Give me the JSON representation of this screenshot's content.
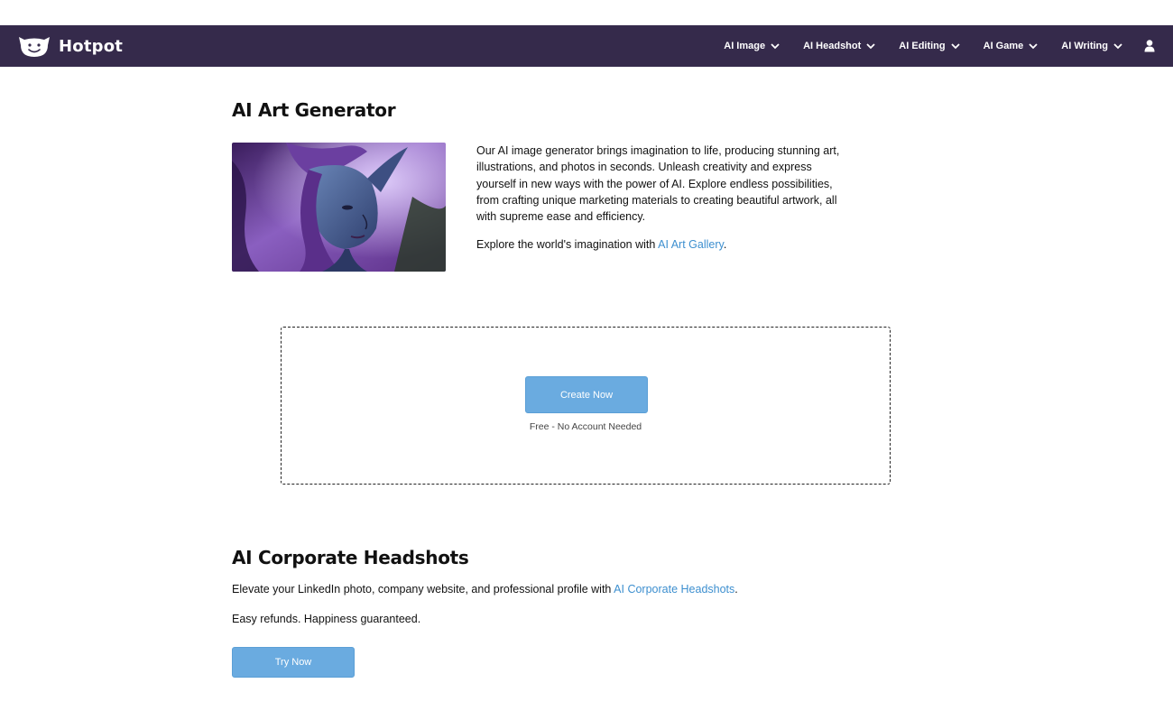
{
  "header": {
    "brand": "Hotpot",
    "nav": [
      {
        "label": "AI Image"
      },
      {
        "label": "AI Headshot"
      },
      {
        "label": "AI Editing"
      },
      {
        "label": "AI Game"
      },
      {
        "label": "AI Writing"
      }
    ],
    "icons": {
      "logo": "hotpot-face-logo",
      "chevron": "chevron-down-icon",
      "user": "user-icon"
    }
  },
  "art_section": {
    "title": "AI Art Generator",
    "description": "Our AI image generator brings imagination to life, producing stunning art, illustrations, and photos in seconds. Unleash creativity and express yourself in new ways with the power of AI. Explore endless possibilities, from crafting unique marketing materials to creating beautiful artwork, all with supreme ease and efficiency.",
    "gallery_prefix": "Explore the world's imagination with ",
    "gallery_link": "AI Art Gallery",
    "gallery_suffix": ".",
    "create_button": "Create Now",
    "create_note": "Free - No Account Needed"
  },
  "headshot_section": {
    "title": "AI Corporate Headshots",
    "text_prefix": "Elevate your LinkedIn photo, company website, and professional profile with ",
    "link": "AI Corporate Headshots",
    "text_suffix": ".",
    "guarantee": "Easy refunds. Happiness guaranteed.",
    "button": "Try Now"
  },
  "colors": {
    "navbar": "#352a4b",
    "link": "#3d8fcf",
    "button": "#6aabe0"
  }
}
